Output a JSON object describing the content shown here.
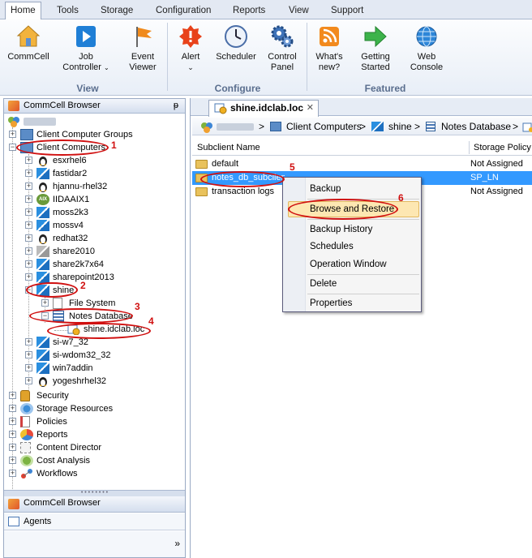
{
  "ribbon": {
    "tabs": [
      "Home",
      "Tools",
      "Storage",
      "Configuration",
      "Reports",
      "View",
      "Support"
    ],
    "active_tab": "Home",
    "buttons": {
      "commcell": "CommCell",
      "job_controller_1": "Job",
      "job_controller_2": "Controller",
      "event_viewer_1": "Event",
      "event_viewer_2": "Viewer",
      "alert": "Alert",
      "scheduler": "Scheduler",
      "control_panel_1": "Control",
      "control_panel_2": "Panel",
      "whats_new_1": "What's",
      "whats_new_2": "new?",
      "getting_started_1": "Getting",
      "getting_started_2": "Started",
      "web_console_1": "Web",
      "web_console_2": "Console"
    },
    "groups": {
      "view": "View",
      "configure": "Configure",
      "featured": "Featured"
    }
  },
  "browser": {
    "title": "CommCell Browser",
    "pin": "ᵽ",
    "tree": {
      "client_computer_groups": "Client Computer Groups",
      "client_computers": "Client Computers",
      "clients": [
        "esxrhel6",
        "fastidar2",
        "hjannu-rhel32",
        "IIDAAIX1",
        "moss2k3",
        "mossv4",
        "redhat32",
        "share2010",
        "share2k7x64",
        "sharepoint2013",
        "shine"
      ],
      "clients_after": [
        "si-w7_32",
        "si-wdom32_32",
        "win7addin",
        "yogeshrhel32"
      ],
      "file_system": "File System",
      "notes_database": "Notes Database",
      "instance": "shine.idclab.loc",
      "top_level": [
        "Security",
        "Storage Resources",
        "Policies",
        "Reports",
        "Content Director",
        "Cost Analysis",
        "Workflows"
      ]
    },
    "aix_badge": "AIX",
    "bottom": {
      "commcell_browser": "CommCell Browser",
      "agents": "Agents",
      "more": "»"
    }
  },
  "annotations": [
    "1",
    "2",
    "3",
    "4",
    "5",
    "6"
  ],
  "document": {
    "tab_title": "shine.idclab.loc",
    "breadcrumb": {
      "sep": ">",
      "client_computers": "Client Computers",
      "client": "shine",
      "agent": "Notes Database"
    },
    "columns": {
      "subclient_name": "Subclient Name",
      "storage_policy": "Storage Policy"
    },
    "rows": [
      {
        "name": "default",
        "policy": "Not Assigned"
      },
      {
        "name": "notes_db_subclient",
        "policy": "SP_LN"
      },
      {
        "name": "transaction logs",
        "policy": "Not Assigned"
      }
    ]
  },
  "context_menu": {
    "items": [
      "Backup",
      "Browse and Restore",
      "Backup History",
      "Schedules",
      "Operation Window",
      "Delete",
      "Properties"
    ]
  },
  "colors": {
    "accent": "#3399ff",
    "annotation": "#d01010",
    "highlight": "#fde7b2"
  }
}
